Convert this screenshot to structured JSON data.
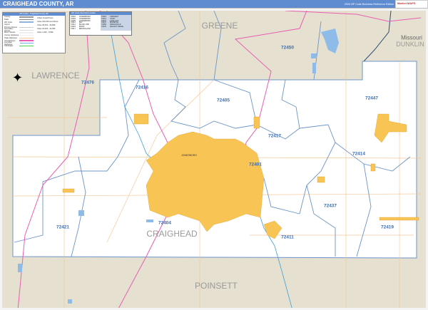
{
  "header": {
    "title": "CRAIGHEAD COUNTY, AR",
    "edition": "2026 ZIP Code Business Reference Edition",
    "logo": "Market MAPS"
  },
  "colors": {
    "header": "#5f8bd0",
    "land": "#e5e0cf",
    "county": "#ffffff",
    "urban": "#f8c454",
    "zip_line": "#6b94c9",
    "water": "#8fbbe8",
    "highway": "#e85fb4",
    "road": "#f4c99a"
  },
  "legend": {
    "title": "ZIP Codes - Craighead County, AR",
    "items": [
      "County",
      "State",
      "ZIP Code",
      "Airport",
      "Primary Streets",
      "Secondary Streets",
      "Minor Streets",
      "County Highways",
      "State Highways",
      "US Highways",
      "Interstate Highways",
      "Toll Roads"
    ],
    "right_items": [
      "Urban Areas/Towns",
      "Cities 100,000 and Above",
      "Cities 25,000 - 99,999",
      "Cities 10,000 - 24,999",
      "Cities 1,000 - 9,999"
    ]
  },
  "zip_table": {
    "title": "ZIP Code Index/Grid Location",
    "headers": [
      "ZIP Code",
      "City Name"
    ],
    "rows": [
      [
        "72401",
        "JONESBORO"
      ],
      [
        "72404",
        "JONESBORO"
      ],
      [
        "72405",
        "JONESBORO"
      ],
      [
        "72411",
        "BAY"
      ],
      [
        "72414",
        "BLACK OAK"
      ],
      [
        "72416",
        "BONO"
      ],
      [
        "72417",
        "BROOKLAND"
      ],
      [
        "72419",
        "CARAWAY"
      ],
      [
        "72421",
        "CASH"
      ],
      [
        "72437",
        "LAKE CITY"
      ],
      [
        "72447",
        "MONETTE"
      ],
      [
        "72450",
        "PARAGOULD"
      ],
      [
        "72476",
        "WALNUT RIDGE"
      ]
    ]
  },
  "map": {
    "counties": {
      "greene": "GREENE",
      "lawrence": "LAWRENCE",
      "craighead": "CRAIGHEAD",
      "poinsett": "POINSETT",
      "dunklin": "DUNKLIN"
    },
    "state": "Missouri",
    "city": "JONESBORO",
    "zips": {
      "z72476": "72476",
      "z72416": "72416",
      "z72405": "72405",
      "z72450": "72450",
      "z72447": "72447",
      "z72417": "72417",
      "z72414": "72414",
      "z72401": "72401",
      "z72437": "72437",
      "z72421": "72421",
      "z72404": "72404",
      "z72411": "72411",
      "z72419": "72419"
    }
  }
}
